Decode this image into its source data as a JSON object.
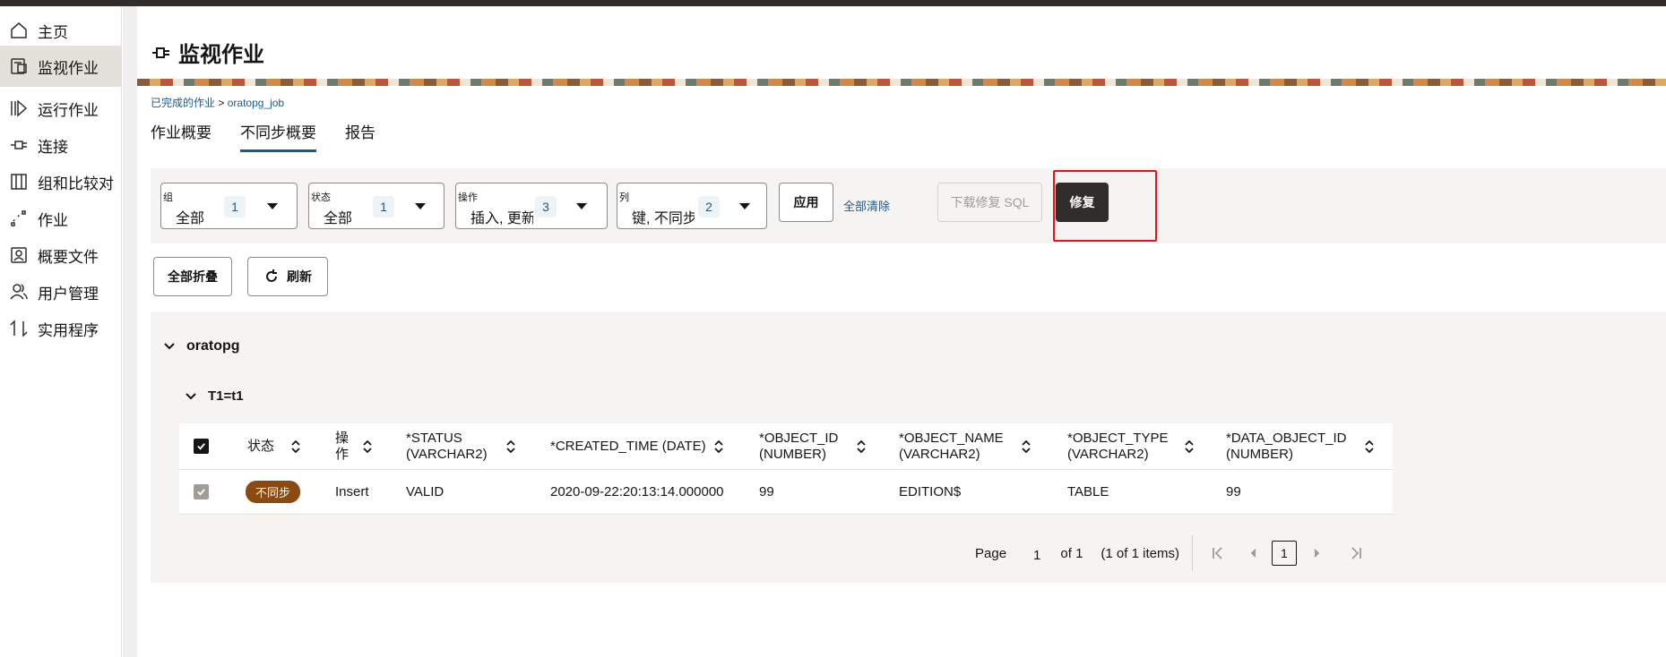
{
  "sidebar": {
    "items": [
      {
        "label": "主页",
        "icon": "home-icon"
      },
      {
        "label": "监视作业",
        "icon": "monitor-jobs-icon",
        "active": true
      },
      {
        "label": "运行作业",
        "icon": "run-job-icon"
      },
      {
        "label": "连接",
        "icon": "connection-icon"
      },
      {
        "label": "组和比较对",
        "icon": "groups-compare-icon"
      },
      {
        "label": "作业",
        "icon": "jobs-icon"
      },
      {
        "label": "概要文件",
        "icon": "profile-icon"
      },
      {
        "label": "用户管理",
        "icon": "users-icon"
      },
      {
        "label": "实用程序",
        "icon": "utilities-icon"
      }
    ]
  },
  "header": {
    "title": "监视作业",
    "icon": "connection-plug-icon"
  },
  "breadcrumb": {
    "parent": "已完成的作业",
    "separator": ">",
    "current": "oratopg_job"
  },
  "tabs": [
    {
      "label": "作业概要"
    },
    {
      "label": "不同步概要",
      "active": true
    },
    {
      "label": "报告"
    }
  ],
  "filters": [
    {
      "label": "组",
      "value": "全部",
      "count": "1"
    },
    {
      "label": "状态",
      "value": "全部",
      "count": "1"
    },
    {
      "label": "操作",
      "value": "插入, 更新",
      "count": "3"
    },
    {
      "label": "列",
      "value": "键, 不同步",
      "count": "2"
    }
  ],
  "actions": {
    "apply": "应用",
    "clear_all": "全部清除",
    "download_sql": "下载修复 SQL",
    "repair": "修复",
    "collapse_all": "全部折叠",
    "refresh": "刷新"
  },
  "group": {
    "name": "oratopg",
    "pair": "T1=t1"
  },
  "table": {
    "columns": [
      "状态",
      "操作",
      "*STATUS (VARCHAR2)",
      "*CREATED_TIME (DATE)",
      "*OBJECT_ID (NUMBER)",
      "*OBJECT_NAME (VARCHAR2)",
      "*OBJECT_TYPE (VARCHAR2)",
      "*DATA_OBJECT_ID (NUMBER)"
    ],
    "col_lines": [
      [
        "状态",
        ""
      ],
      [
        "操",
        "作"
      ],
      [
        "*STATUS",
        "(VARCHAR2)"
      ],
      [
        "*CREATED_TIME (DATE)",
        ""
      ],
      [
        "*OBJECT_ID",
        "(NUMBER)"
      ],
      [
        "*OBJECT_NAME",
        "(VARCHAR2)"
      ],
      [
        "*OBJECT_TYPE",
        "(VARCHAR2)"
      ],
      [
        "*DATA_OBJECT_ID",
        "(NUMBER)"
      ]
    ],
    "rows": [
      {
        "status": "不同步",
        "operation": "Insert",
        "STATUS": "VALID",
        "CREATED_TIME": "2020-09-22:20:13:14.000000",
        "OBJECT_ID": "99",
        "OBJECT_NAME": "EDITION$",
        "OBJECT_TYPE": "TABLE",
        "DATA_OBJECT_ID": "99"
      }
    ]
  },
  "pagination": {
    "page_label": "Page",
    "page": "1",
    "of_label": "of 1",
    "items_label": "(1 of 1 items)",
    "current": "1"
  },
  "colors": {
    "accent": "#1a5a90",
    "dark": "#312d2a",
    "badge": "#8a4a10",
    "highlight": "#e8121b"
  }
}
